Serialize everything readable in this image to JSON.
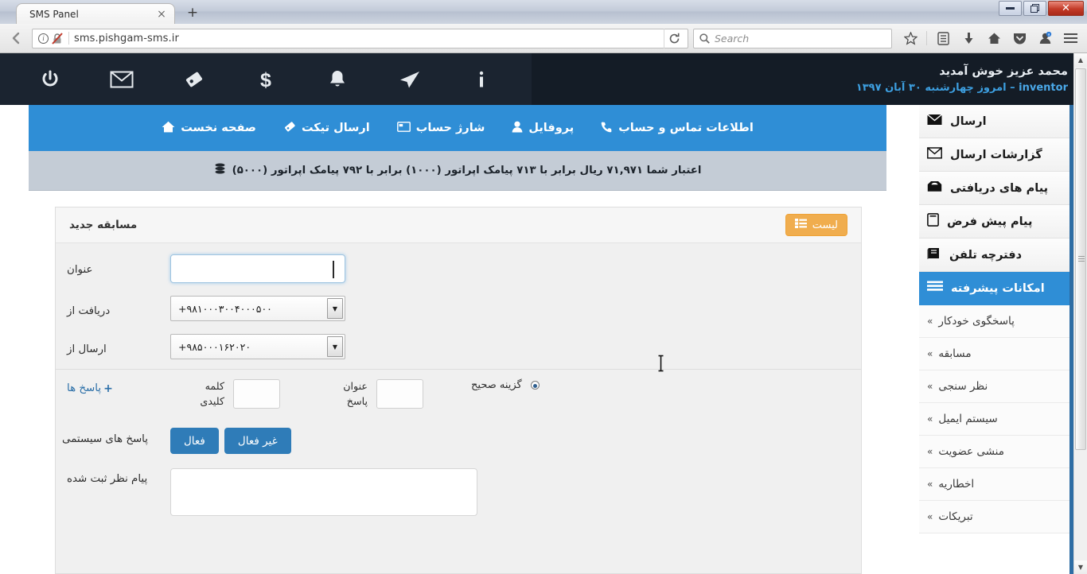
{
  "browser": {
    "tab_title": "SMS Panel",
    "tab_close": "×",
    "new_tab": "+",
    "url": "sms.pishgam-sms.ir",
    "search_placeholder": "Search",
    "window_minimize": "—",
    "window_restore": "❐",
    "window_close": "✕"
  },
  "topbar": {
    "icons": [
      "power-icon",
      "envelope-icon",
      "tag-icon",
      "dollar-icon",
      "bell-icon",
      "paper-plane-icon",
      "info-icon"
    ],
    "welcome_name": "محمد عزیز خوش آمدید",
    "username": "inventor",
    "date_line": "– امروز چهارشنبه ۳۰ آبان ۱۳۹۷"
  },
  "nav": {
    "items": [
      {
        "label": "صفحه نخست",
        "icon": "home-icon"
      },
      {
        "label": "ارسال تیکت",
        "icon": "tag-icon"
      },
      {
        "label": "شارژ حساب",
        "icon": "credit-card-icon"
      },
      {
        "label": "پروفایل",
        "icon": "user-icon"
      },
      {
        "label": "اطلاعات تماس و حساب",
        "icon": "phone-icon"
      }
    ]
  },
  "credit": {
    "icon": "coins-icon",
    "text": "اعتبار شما ۷۱,۹۷۱ ریال برابر با ۷۱۳ پیامک اپراتور (۱۰۰۰) برابر با ۷۹۲ پیامک اپراتور (۵۰۰۰)"
  },
  "sidebar": {
    "items": [
      {
        "label": "ارسال",
        "icon": "envelope-solid-icon",
        "active": false
      },
      {
        "label": "گزارشات ارسال",
        "icon": "envelope-open-icon",
        "active": false
      },
      {
        "label": "پیام های دریافتی",
        "icon": "inbox-icon",
        "active": false
      },
      {
        "label": "پیام پیش فرض",
        "icon": "note-icon",
        "active": false
      },
      {
        "label": "دفترچه تلفن",
        "icon": "book-icon",
        "active": false
      },
      {
        "label": "امکانات پیشرفته",
        "icon": "list-icon",
        "active": true
      }
    ],
    "submenu": [
      {
        "label": "پاسخگوی خودکار"
      },
      {
        "label": "مسابقه"
      },
      {
        "label": "نظر سنجی"
      },
      {
        "label": "سیستم ایمیل"
      },
      {
        "label": "منشی عضویت"
      },
      {
        "label": "اخطاریه"
      },
      {
        "label": "تبریکات"
      }
    ],
    "chevron": "»"
  },
  "form": {
    "panel_title": "مسابقه جدید",
    "list_button": "لیست",
    "title_label": "عنوان",
    "title_value": "",
    "receive_from_label": "دریافت از",
    "receive_from_value": "+۹۸۱۰۰۰۳۰۰۴۰۰۰۵۰۰",
    "send_from_label": "ارسال از",
    "send_from_value": "+۹۸۵۰۰۰۱۶۲۰۲۰",
    "answers_label": "پاسخ ها",
    "answers_add": "+",
    "keyword_label": "کلمه کلیدی",
    "keyword_value": "",
    "answer_title_label": "عنوان پاسخ",
    "answer_title_value": "",
    "correct_option_label": "گزینه صحیح",
    "system_answers_label": "پاسخ های سیستمی",
    "active_button": "فعال",
    "inactive_button": "غیر فعال",
    "registered_message_label": "پیام نظر ثبت شده",
    "registered_message_value": ""
  },
  "colors": {
    "primary_blue": "#2f8ed6",
    "dark_header": "#141c26",
    "orange": "#f0ad4e",
    "button_blue": "#2f7cb8",
    "credit_bar": "#c4ccd6"
  }
}
